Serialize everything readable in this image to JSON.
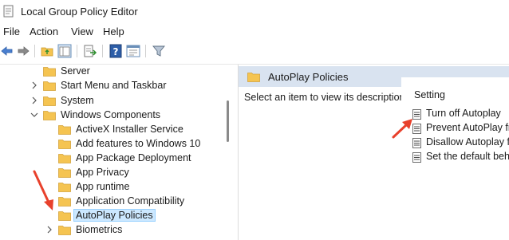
{
  "window": {
    "title": "Local Group Policy Editor"
  },
  "menu": [
    "File",
    "Action",
    "View",
    "Help"
  ],
  "toolbar": {
    "buttons": [
      "back-icon",
      "forward-icon",
      "up-folder-icon",
      "show-hide-tree-icon",
      "export-list-icon",
      "help-icon",
      "properties-icon",
      "filter-icon"
    ]
  },
  "tree": {
    "items": [
      {
        "label": "Server",
        "expander": "none",
        "depth": 0
      },
      {
        "label": "Start Menu and Taskbar",
        "expander": "collapsed",
        "depth": 0
      },
      {
        "label": "System",
        "expander": "collapsed",
        "depth": 0
      },
      {
        "label": "Windows Components",
        "expander": "expanded",
        "depth": 0
      },
      {
        "label": "ActiveX Installer Service",
        "expander": "none",
        "depth": 1
      },
      {
        "label": "Add features to Windows 10",
        "expander": "none",
        "depth": 1
      },
      {
        "label": "App Package Deployment",
        "expander": "none",
        "depth": 1
      },
      {
        "label": "App Privacy",
        "expander": "none",
        "depth": 1
      },
      {
        "label": "App runtime",
        "expander": "none",
        "depth": 1
      },
      {
        "label": "Application Compatibility",
        "expander": "none",
        "depth": 1
      },
      {
        "label": "AutoPlay Policies",
        "expander": "none",
        "depth": 1,
        "selected": true
      },
      {
        "label": "Biometrics",
        "expander": "collapsed",
        "depth": 1
      }
    ]
  },
  "right_pane": {
    "header_title": "AutoPlay Policies",
    "description": "Select an item to view its description.",
    "setting_header": "Setting",
    "settings": [
      "Turn off Autoplay",
      "Prevent AutoPlay fr",
      "Disallow Autoplay f",
      "Set the default beha"
    ]
  },
  "colors": {
    "header_bg": "#d9e3f0",
    "selection_bg": "#cce8ff",
    "folder_yellow": "#f5c451",
    "annotation_red": "#e8412c"
  }
}
